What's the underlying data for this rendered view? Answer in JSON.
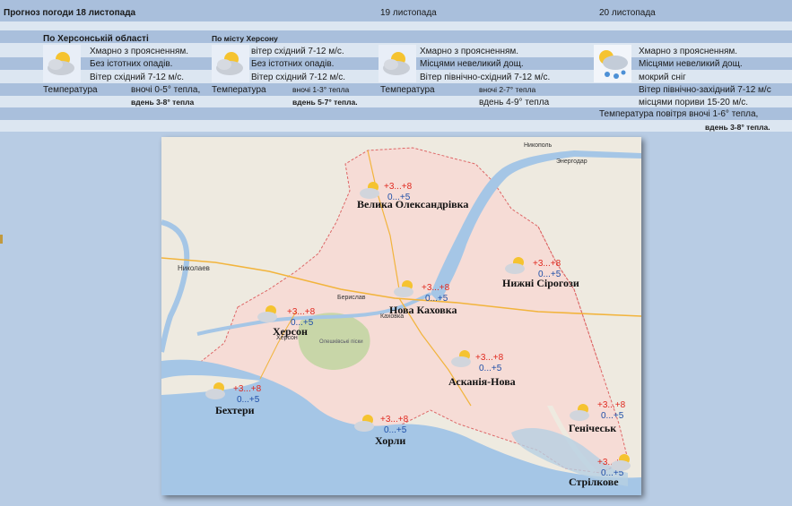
{
  "header": {
    "title": "Прогноз погоди 18 листопада",
    "day2": "19 листопада",
    "day3": "20 листопада"
  },
  "region": {
    "heading": "По Херсонській області",
    "line1": "Хмарно з проясненням.",
    "line2": "Без істотних опадів.",
    "line3": "Вітер східний 7-12 м/с.",
    "temp_label": "Температура",
    "night": "вночі 0-5° тепла,",
    "day": "вдень 3-8° тепла"
  },
  "city": {
    "heading": "По місту Херсону",
    "line1": "вітер східний 7-12 м/с.",
    "line2": "Без істотних опадів.",
    "line3": "Вітер східний 7-12 м/с.",
    "temp_label": "Температура",
    "night": "вночі 1-3° тепла",
    "day": "вдень 5-7° тепла."
  },
  "day19": {
    "line1": "Хмарно з проясненням.",
    "line2": "Місцями невеликий дощ.",
    "line3": "Вітер північно-східний 7-12 м/с.",
    "temp_label": "Температура",
    "night": "вночі 2-7° тепла",
    "day": "вдень  4-9°  тепла"
  },
  "day20": {
    "line1": "Хмарно з проясненням.",
    "line2": "Місцями невеликий дощ.",
    "line3": "мокрий сніг",
    "line4": "Вітер північно-західний 7-12 м/с",
    "line5": "місцями пориви 15-20 м/с.",
    "line6": "Температура повітря вночі 1-6° тепла,",
    "line7": "вдень 3-8° тепла."
  },
  "map": {
    "cities": [
      {
        "name": "Велика Олександрівка",
        "hi": "+3...+8",
        "lo": "0...+5"
      },
      {
        "name": "Нижні Сірогози",
        "hi": "+3...+8",
        "lo": "0...+5"
      },
      {
        "name": "Нова Каховка",
        "hi": "+3...+8",
        "lo": "0...+5"
      },
      {
        "name": "Херсон",
        "hi": "+3...+8",
        "lo": "0...+5"
      },
      {
        "name": "Асканія-Нова",
        "hi": "+3...+8",
        "lo": "0...+5"
      },
      {
        "name": "Бехтери",
        "hi": "+3...+8",
        "lo": "0...+5"
      },
      {
        "name": "Хорли",
        "hi": "+3...+8",
        "lo": "0...+5"
      },
      {
        "name": "Генічеськ",
        "hi": "+3...+8",
        "lo": "0...+5"
      },
      {
        "name": "Стрілкове",
        "hi": "+3...+8",
        "lo": "0...+5"
      }
    ],
    "base_labels": {
      "mykolaiv": "Николаев",
      "kakhovka": "Каховка",
      "kherson_small": "Херсон",
      "nikopol": "Никополь",
      "energodar": "Энергодар",
      "beryslav": "Берислав",
      "oleshky": "Олешкiвськi пiски"
    }
  },
  "colors": {
    "page_bg": "#b8cce4",
    "band_light": "#dce6f1",
    "band_dark": "#a9bfdc",
    "temp_hi": "#e0281e",
    "temp_lo": "#1f4fa8",
    "region_fill": "#f6dcd6",
    "water": "#a5c6e6"
  }
}
